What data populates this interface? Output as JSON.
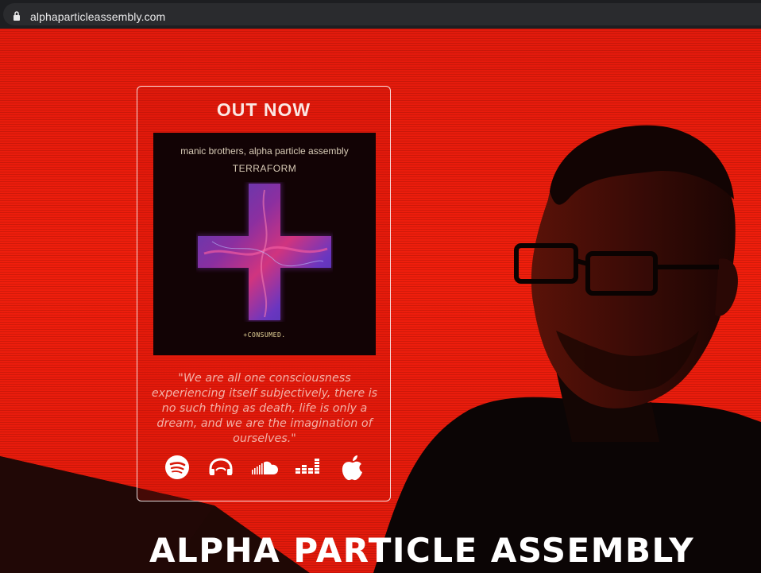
{
  "browser": {
    "url": "alphaparticleassembly.com",
    "icons": [
      "lock-icon"
    ]
  },
  "card": {
    "title": "OUT NOW",
    "cover": {
      "artists": "manic brothers, alpha particle assembly",
      "album": "TERRAFORM",
      "tagline": "+CONSUMED."
    },
    "quote": "\"We are all one consciousness experiencing itself subjectively, there is no such thing as death, life is only a dream, and we are the imagination of ourselves.\"",
    "streaming_icons": [
      "spotify-icon",
      "audiomack-icon",
      "soundcloud-icon",
      "deezer-icon",
      "apple-music-icon"
    ]
  },
  "brand": {
    "name": "ALPHA PARTICLE ASSEMBLY"
  },
  "colors": {
    "background": "#e81b0b",
    "card_border": "#ffffff",
    "silhouette": "#0b0505"
  }
}
